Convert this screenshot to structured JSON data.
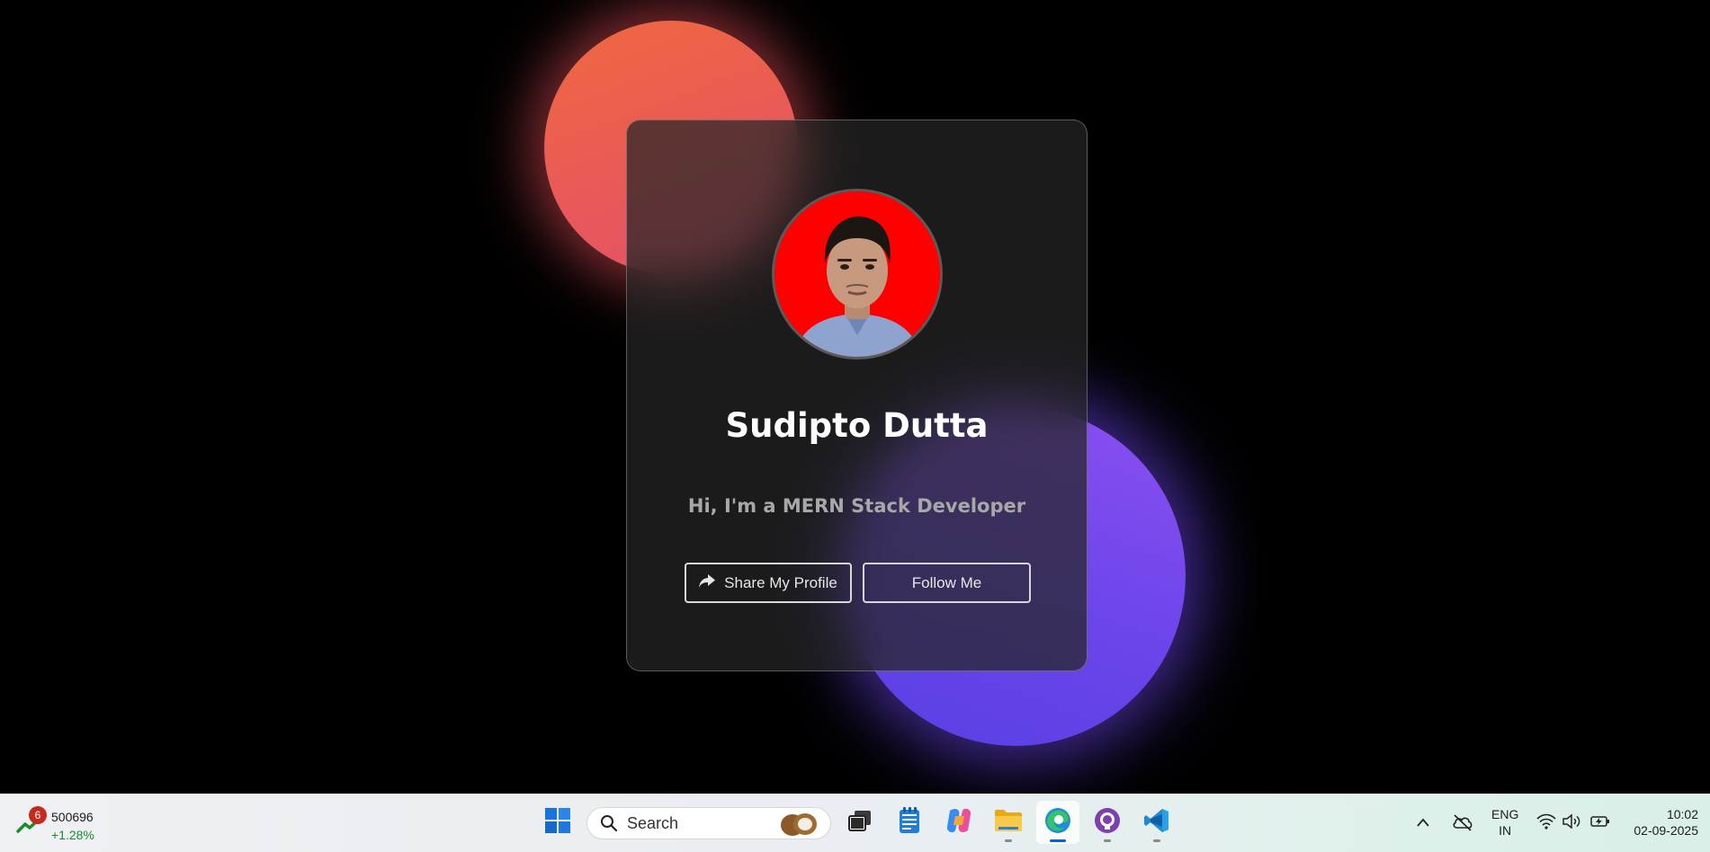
{
  "profile": {
    "name": "Sudipto Dutta",
    "subtitle": "Hi, I'm a MERN Stack Developer",
    "share_label": "Share My Profile",
    "follow_label": "Follow Me",
    "avatar_bg": "#ff0000"
  },
  "colors": {
    "page_bg": "#000000",
    "blob_red": "#e85a58",
    "blob_purple": "#6a45ea",
    "button_border": "#d8d8d8"
  },
  "taskbar": {
    "stock": {
      "badge": "6",
      "value": "500696",
      "change": "+1.28%"
    },
    "search_placeholder": "Search",
    "apps": [
      "windows-start",
      "search",
      "task-view",
      "notepad",
      "copilot",
      "file-explorer",
      "edge",
      "github-desktop",
      "vscode"
    ],
    "tray": {
      "lang_top": "ENG",
      "lang_bottom": "IN",
      "time": "10:02",
      "date": "02-09-2025"
    }
  }
}
